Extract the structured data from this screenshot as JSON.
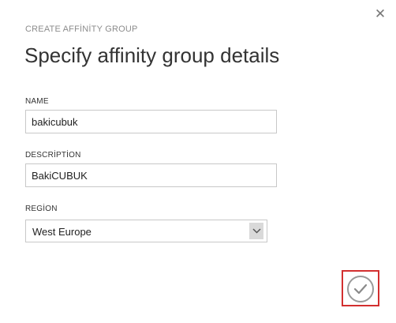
{
  "dialog": {
    "eyebrow": "CREATE AFFİNİTY GROUP",
    "title": "Specify affinity group details",
    "close_icon": "close-icon"
  },
  "form": {
    "name_label": "NAME",
    "name_value": "bakicubuk",
    "description_label": "DESCRİPTİON",
    "description_value": "BakiCUBUK",
    "region_label": "REGİON",
    "region_value": "West Europe"
  },
  "actions": {
    "confirm_icon": "checkmark-icon",
    "highlight_color": "#d32f2f"
  }
}
